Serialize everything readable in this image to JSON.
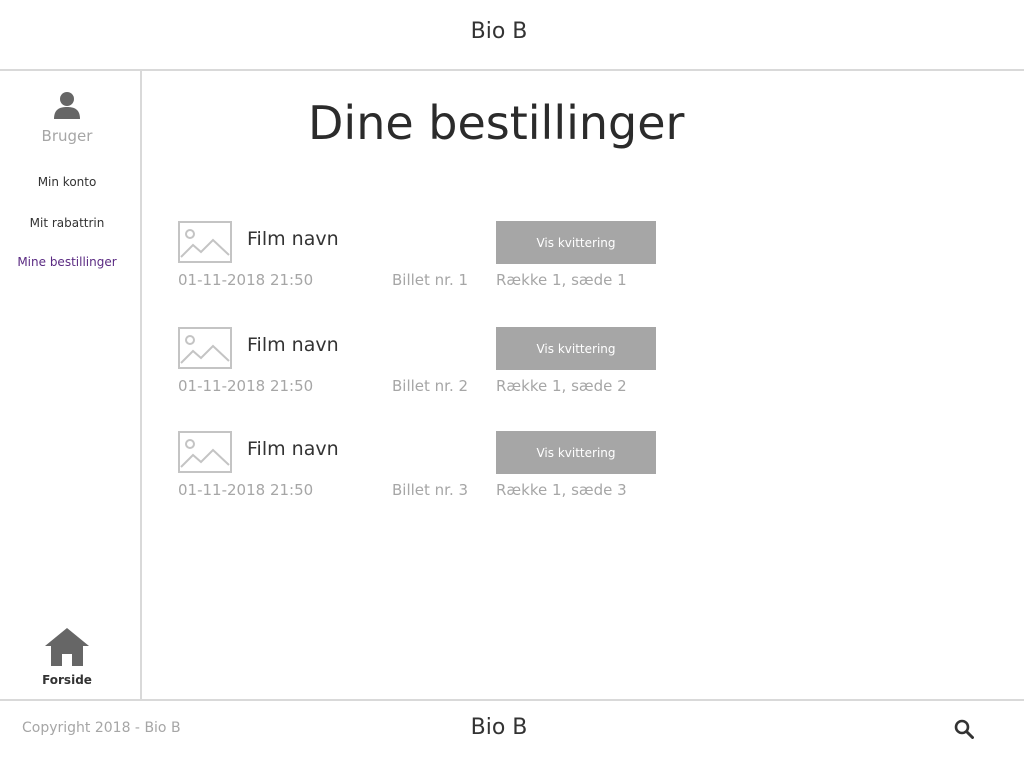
{
  "header": {
    "title": "Bio B"
  },
  "sidebar": {
    "user_label": "Bruger",
    "items": [
      {
        "label": "Min konto"
      },
      {
        "label": "Mit rabattrin"
      },
      {
        "label": "Mine bestillinger"
      }
    ],
    "home_label": "Forside"
  },
  "main": {
    "title": "Dine bestillinger",
    "orders": [
      {
        "film": "Film navn",
        "button": "Vis kvittering",
        "datetime": "01-11-2018 21:50",
        "ticket": "Billet nr. 1",
        "seat": "Række 1, sæde 1"
      },
      {
        "film": "Film navn",
        "button": "Vis kvittering",
        "datetime": "01-11-2018 21:50",
        "ticket": "Billet nr. 2",
        "seat": "Række 1, sæde 2"
      },
      {
        "film": "Film navn",
        "button": "Vis kvittering",
        "datetime": "01-11-2018 21:50",
        "ticket": "Billet nr. 3",
        "seat": "Række 1, sæde 3"
      }
    ]
  },
  "footer": {
    "copyright": "Copyright 2018 - Bio B",
    "title": "Bio B",
    "search_icon": "search-icon"
  },
  "colors": {
    "accent": "#5a2a82",
    "button_bg": "#a6a6a6",
    "muted_text": "#a6a6a6",
    "divider": "#d9d9d9"
  }
}
